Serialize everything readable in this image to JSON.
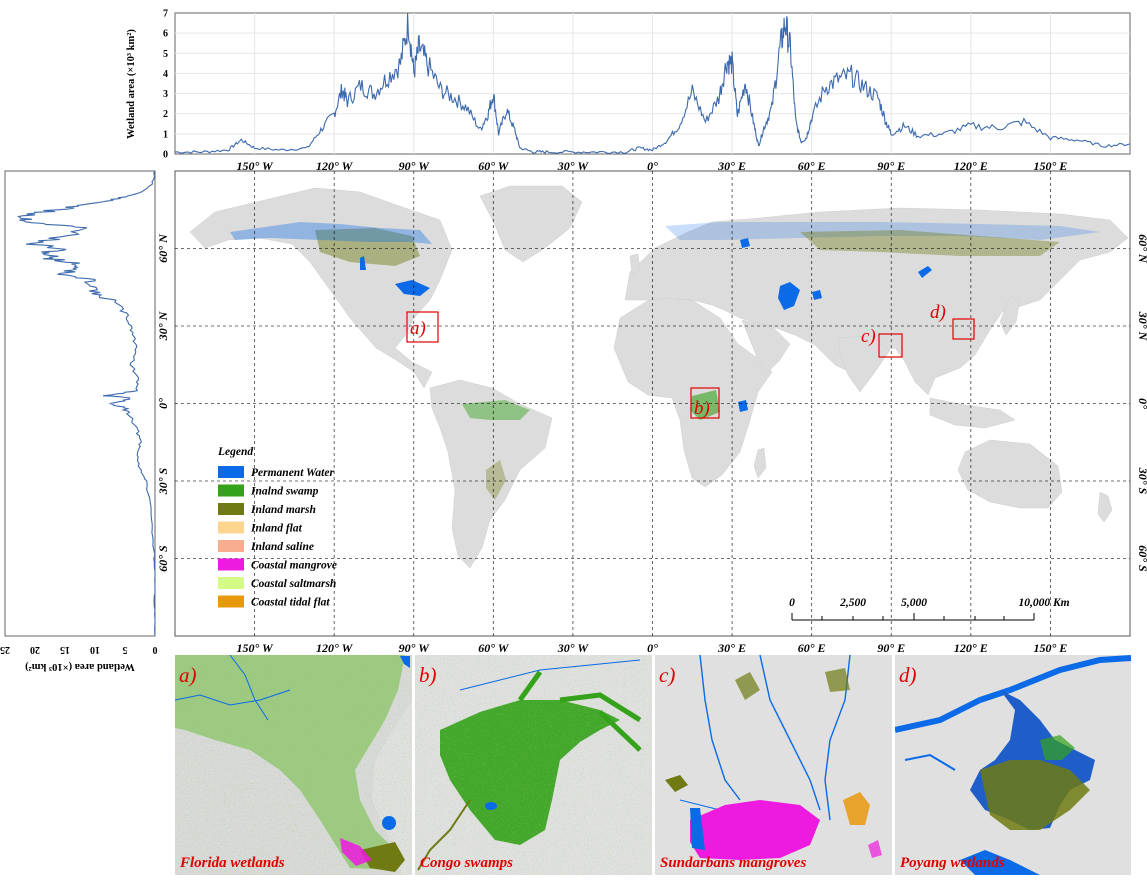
{
  "top_profile": {
    "ylabel": "Wetland area (×10³ km²)",
    "yticks": [
      "0",
      "1",
      "2",
      "3",
      "4",
      "5",
      "6",
      "7"
    ],
    "xticks": [
      "150° W",
      "120° W",
      "90° W",
      "60° W",
      "30° W",
      "0°",
      "30° E",
      "60° E",
      "90° E",
      "120° E",
      "150° E"
    ]
  },
  "side_profile": {
    "xlabel": "Wetland area (×10³ km²)",
    "xticks": [
      "25",
      "20",
      "15",
      "10",
      "5",
      "0"
    ]
  },
  "map": {
    "lat_labels": [
      "60° N",
      "30° N",
      "0°",
      "30° S",
      "60° S"
    ],
    "lon_labels": [
      "150° W",
      "120° W",
      "90° W",
      "60° W",
      "30° W",
      "0°",
      "30° E",
      "60° E",
      "90° E",
      "120° E",
      "150° E"
    ],
    "boxes": [
      {
        "letter": "a)",
        "region": "Florida"
      },
      {
        "letter": "b)",
        "region": "Congo"
      },
      {
        "letter": "c)",
        "region": "Sundarbans"
      },
      {
        "letter": "d)",
        "region": "Poyang"
      }
    ],
    "legend": {
      "title": "Legend",
      "items": [
        {
          "label": "Permanent Water",
          "color": "#0a6ae8"
        },
        {
          "label": "Inalnd swamp",
          "color": "#34a21a"
        },
        {
          "label": "Inland marsh",
          "color": "#6f7a12"
        },
        {
          "label": "Inland flat",
          "color": "#fdd58e"
        },
        {
          "label": "Inland saline",
          "color": "#f8ad8f"
        },
        {
          "label": "Coastal mangrove",
          "color": "#ee1ae0"
        },
        {
          "label": "Coastal saltmarsh",
          "color": "#d4fb86"
        },
        {
          "label": "Coastal tidal flat",
          "color": "#e8980a"
        }
      ]
    },
    "scale": {
      "labels": [
        "0",
        "2,500",
        "5,000",
        "10,000 Km"
      ]
    }
  },
  "chart_data": [
    {
      "type": "line",
      "title": "",
      "xlabel": "",
      "ylabel": "Wetland area (×10³ km²)",
      "xlim": [
        -180,
        180
      ],
      "ylim": [
        0,
        7
      ],
      "x": [
        -180,
        -170,
        -160,
        -155,
        -150,
        -140,
        -130,
        -125,
        -120,
        -117,
        -115,
        -110,
        -105,
        -100,
        -95,
        -92,
        -90,
        -88,
        -85,
        -80,
        -75,
        -70,
        -65,
        -62,
        -60,
        -58,
        -55,
        -52,
        -50,
        -45,
        -40,
        -30,
        -20,
        -10,
        -5,
        0,
        5,
        10,
        15,
        20,
        25,
        28,
        30,
        32,
        35,
        38,
        40,
        42,
        45,
        48,
        50,
        52,
        54,
        56,
        58,
        60,
        65,
        70,
        75,
        80,
        85,
        88,
        90,
        95,
        100,
        110,
        120,
        130,
        140,
        150,
        160,
        170,
        180
      ],
      "series": [
        {
          "name": "",
          "values": [
            0.1,
            0.1,
            0.2,
            0.7,
            0.3,
            0.2,
            0.3,
            1.2,
            2.0,
            3.2,
            2.6,
            3.4,
            3.0,
            3.8,
            4.5,
            6.6,
            4.0,
            5.3,
            4.5,
            3.2,
            2.8,
            2.3,
            1.2,
            2.0,
            3.0,
            1.0,
            2.2,
            1.2,
            0.3,
            0.1,
            0.1,
            0.1,
            0.1,
            0.1,
            0.3,
            0.2,
            0.6,
            1.4,
            3.1,
            1.6,
            2.8,
            4.6,
            4.5,
            1.9,
            3.6,
            1.6,
            0.4,
            1.3,
            2.3,
            5.2,
            6.5,
            5.2,
            1.6,
            0.6,
            0.8,
            1.8,
            3.3,
            3.7,
            3.9,
            3.3,
            2.8,
            1.6,
            1.0,
            1.4,
            0.9,
            1.0,
            1.4,
            1.3,
            1.6,
            0.8,
            0.7,
            0.4,
            0.5
          ]
        }
      ]
    },
    {
      "type": "line",
      "title": "",
      "xlabel": "Wetland area (×10³ km²)",
      "ylabel": "",
      "xlim": [
        25,
        0
      ],
      "ylim": [
        -90,
        90
      ],
      "x": [
        90,
        85,
        82,
        80,
        78,
        76,
        74,
        72,
        70,
        68,
        65,
        62,
        60,
        58,
        56,
        54,
        52,
        50,
        48,
        45,
        42,
        40,
        35,
        30,
        25,
        20,
        15,
        10,
        5,
        3,
        2,
        0,
        -2,
        -5,
        -10,
        -15,
        -20,
        -25,
        -30,
        -40,
        -50,
        -60,
        -70,
        -80,
        -90
      ],
      "series": [
        {
          "name": "",
          "values": [
            0,
            0.5,
            2,
            5,
            9,
            14,
            19,
            22,
            20,
            12,
            14,
            21,
            16,
            18,
            17,
            13,
            13,
            16,
            11,
            10,
            10,
            7,
            5,
            4,
            3.5,
            3,
            4,
            3,
            3,
            8,
            4,
            7,
            5,
            4,
            3,
            2.5,
            3,
            2.5,
            1.5,
            0.8,
            0.4,
            0.05,
            0,
            0,
            0
          ]
        }
      ]
    }
  ],
  "panels": [
    {
      "letter": "a)",
      "caption": "Florida wetlands"
    },
    {
      "letter": "b)",
      "caption": "Congo swamps"
    },
    {
      "letter": "c)",
      "caption": "Sundarbans mangroves"
    },
    {
      "letter": "d)",
      "caption": "Poyang wetlands"
    }
  ]
}
